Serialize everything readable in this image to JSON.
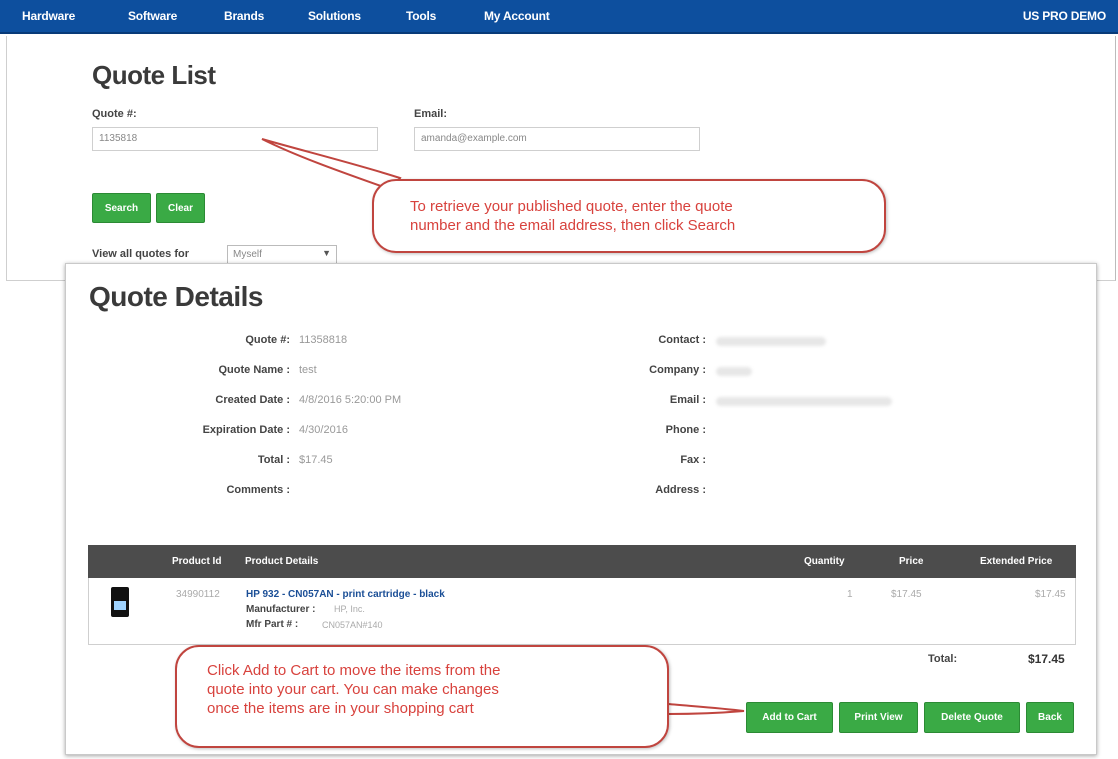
{
  "nav": {
    "items": [
      "Hardware",
      "Software",
      "Brands",
      "Solutions",
      "Tools",
      "My Account"
    ],
    "account": "US PRO DEMO"
  },
  "quote_list": {
    "title": "Quote List",
    "quote_label": "Quote #:",
    "quote_value": "1135818",
    "email_label": "Email:",
    "email_value": "amanda@example.com",
    "search_label": "Search",
    "clear_label": "Clear",
    "view_all_label": "View all quotes for",
    "view_all_value": "Myself"
  },
  "quote_details": {
    "title": "Quote Details",
    "left": [
      {
        "key": "Quote #:",
        "value": "11358818"
      },
      {
        "key": "Quote Name :",
        "value": "test"
      },
      {
        "key": "Created Date :",
        "value": "4/8/2016 5:20:00 PM"
      },
      {
        "key": "Expiration Date :",
        "value": "4/30/2016"
      },
      {
        "key": "Total :",
        "value": "$17.45"
      },
      {
        "key": "Comments :",
        "value": ""
      }
    ],
    "right": [
      {
        "key": "Contact :"
      },
      {
        "key": "Company :"
      },
      {
        "key": "Email :"
      },
      {
        "key": "Phone :"
      },
      {
        "key": "Fax :"
      },
      {
        "key": "Address :"
      }
    ]
  },
  "table": {
    "headers": {
      "product_id": "Product Id",
      "product_details": "Product Details",
      "quantity": "Quantity",
      "price": "Price",
      "extended_price": "Extended Price"
    },
    "rows": [
      {
        "product_id": "34990112",
        "name": "HP 932 - CN057AN - print cartridge - black",
        "manufacturer_label": "Manufacturer :",
        "manufacturer": "HP, Inc.",
        "mfr_part_label": "Mfr Part # :",
        "mfr_part": "CN057AN#140",
        "quantity": "1",
        "price": "$17.45",
        "extended_price": "$17.45"
      }
    ],
    "total_label": "Total:",
    "total_value": "$17.45"
  },
  "buttons": {
    "add_to_cart": "Add to Cart",
    "print_view": "Print View",
    "delete_quote": "Delete Quote",
    "back": "Back"
  },
  "callouts": {
    "retrieve": [
      "To retrieve your published quote, enter the quote",
      "number and the email address, then click Search"
    ],
    "add_to_cart": [
      "Click Add to Cart to move the items from the",
      "quote into your cart.  You can make changes",
      "once the items are in your shopping cart"
    ]
  },
  "colors": {
    "nav": "#0d4f9e",
    "button": "#3aaa45",
    "callout": "#c0453f",
    "table_header": "#4c4c4c",
    "link": "#1a4e96"
  }
}
